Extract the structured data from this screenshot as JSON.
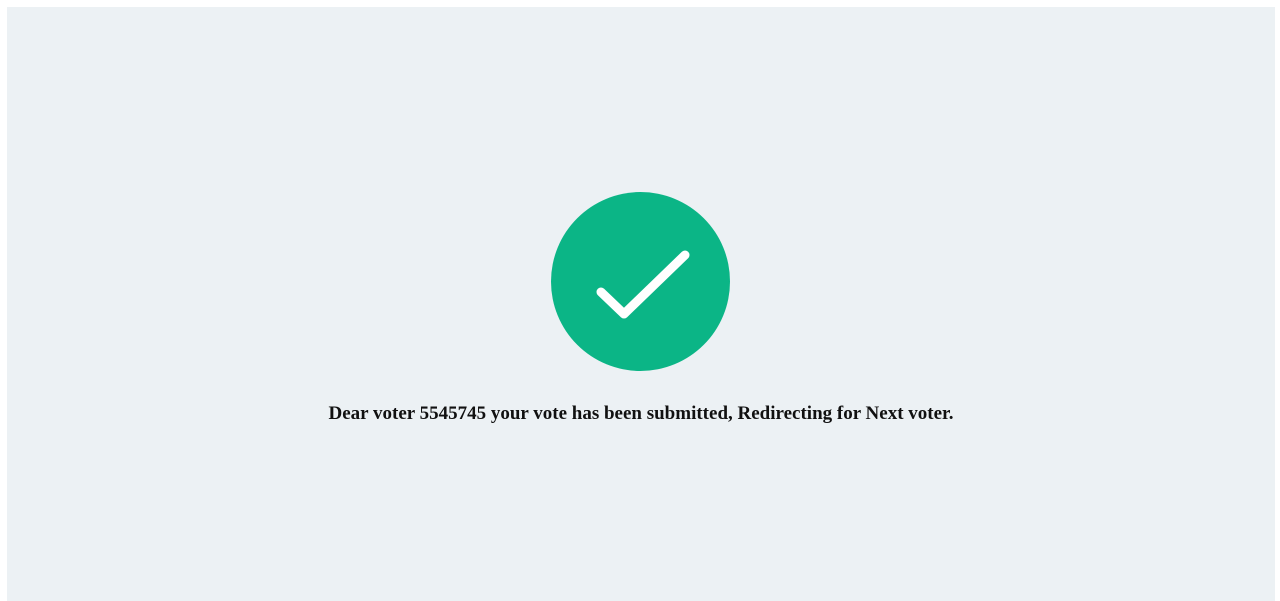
{
  "status": {
    "icon": "checkmark-icon",
    "icon_color": "#0bb586",
    "background_color": "#ecf1f4",
    "message": "Dear voter 5545745 your vote has been submitted, Redirecting for Next voter."
  }
}
